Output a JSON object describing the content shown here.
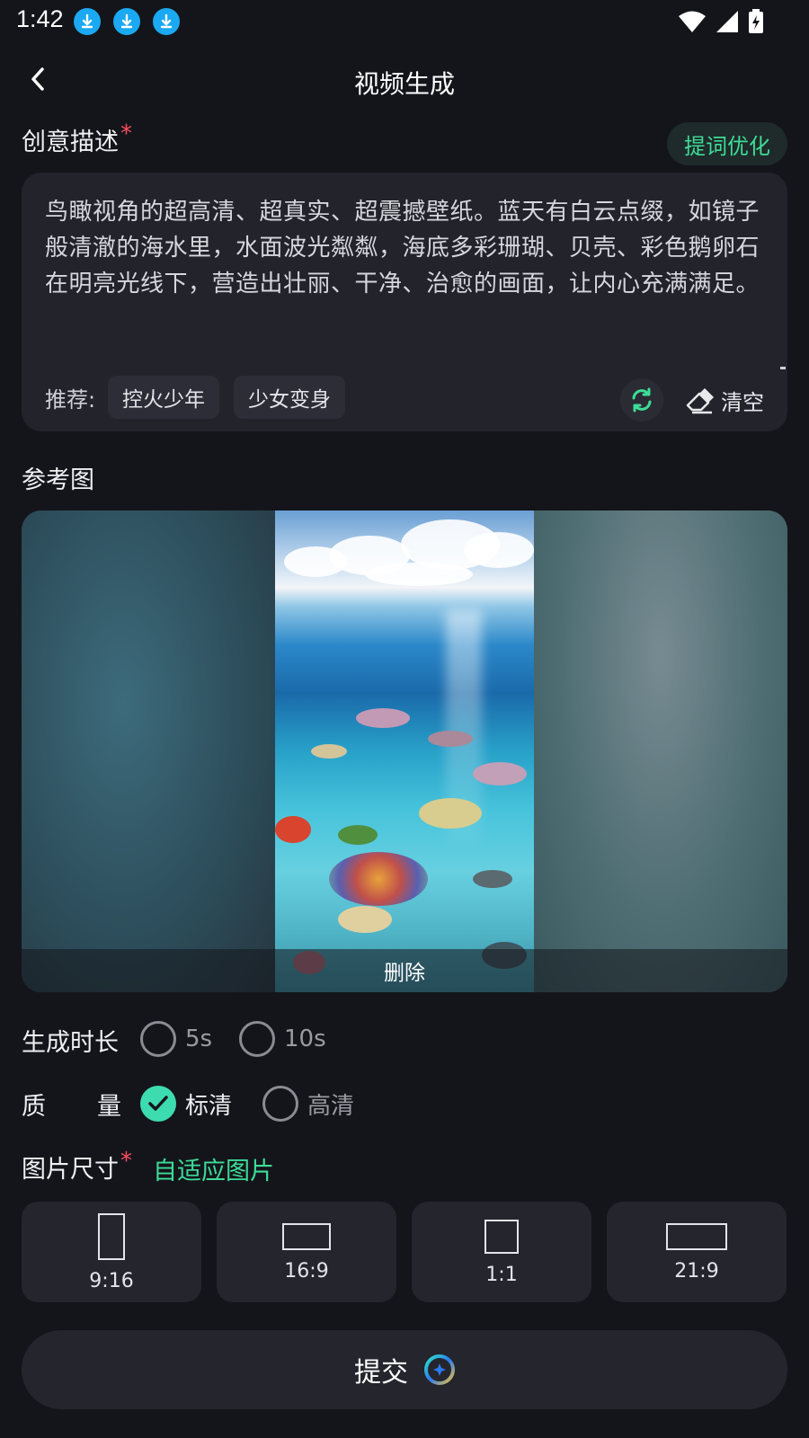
{
  "status_bar": {
    "time": "1:42"
  },
  "header": {
    "title": "视频生成"
  },
  "description": {
    "label": "创意描述",
    "required_mark": "*",
    "optimize_label": "提词优化",
    "text": "鸟瞰视角的超高清、超真实、超震撼壁纸。蓝天有白云点缀，如镜子般清澈的海水里，水面波光粼粼，海底多彩珊瑚、贝壳、彩色鹅卵石在明亮光线下，营造出壮丽、干净、治愈的画面，让内心充满满足。",
    "recommend_label": "推荐:",
    "chips": [
      "控火少年",
      "少女变身"
    ],
    "clear_label": "清空"
  },
  "reference": {
    "label": "参考图",
    "delete_label": "删除"
  },
  "duration": {
    "label": "生成时长",
    "options": [
      "5s",
      "10s"
    ],
    "selected": null
  },
  "quality": {
    "label_1": "质",
    "label_2": "量",
    "options": [
      "标清",
      "高清"
    ],
    "selected": "标清"
  },
  "size": {
    "label": "图片尺寸",
    "required_mark": "*",
    "adaptive_label": "自适应图片",
    "ratios": [
      "9:16",
      "16:9",
      "1:1",
      "21:9"
    ]
  },
  "submit": {
    "label": "提交"
  },
  "colors": {
    "accent_green": "#3ddc97",
    "required_red": "#ff4d5e",
    "download_blue": "#1aa9f2",
    "background": "#14151b",
    "card": "#22232b"
  }
}
